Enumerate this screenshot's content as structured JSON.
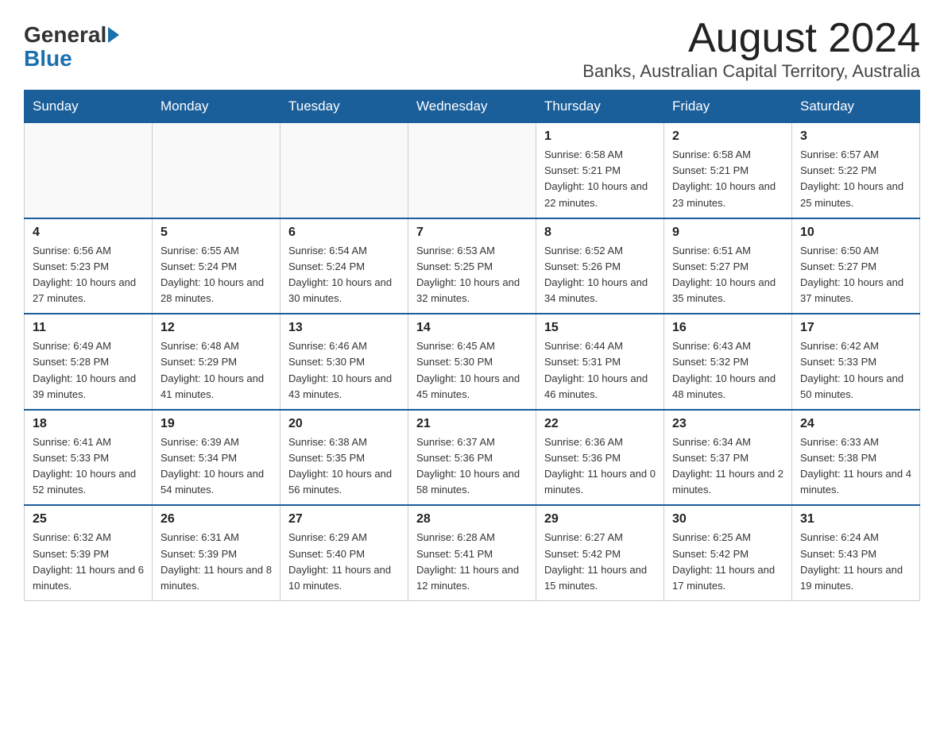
{
  "header": {
    "logo_text_general": "General",
    "logo_text_blue": "Blue",
    "month_title": "August 2024",
    "location": "Banks, Australian Capital Territory, Australia"
  },
  "calendar": {
    "days_of_week": [
      "Sunday",
      "Monday",
      "Tuesday",
      "Wednesday",
      "Thursday",
      "Friday",
      "Saturday"
    ],
    "weeks": [
      [
        {
          "day": "",
          "info": ""
        },
        {
          "day": "",
          "info": ""
        },
        {
          "day": "",
          "info": ""
        },
        {
          "day": "",
          "info": ""
        },
        {
          "day": "1",
          "info": "Sunrise: 6:58 AM\nSunset: 5:21 PM\nDaylight: 10 hours and 22 minutes."
        },
        {
          "day": "2",
          "info": "Sunrise: 6:58 AM\nSunset: 5:21 PM\nDaylight: 10 hours and 23 minutes."
        },
        {
          "day": "3",
          "info": "Sunrise: 6:57 AM\nSunset: 5:22 PM\nDaylight: 10 hours and 25 minutes."
        }
      ],
      [
        {
          "day": "4",
          "info": "Sunrise: 6:56 AM\nSunset: 5:23 PM\nDaylight: 10 hours and 27 minutes."
        },
        {
          "day": "5",
          "info": "Sunrise: 6:55 AM\nSunset: 5:24 PM\nDaylight: 10 hours and 28 minutes."
        },
        {
          "day": "6",
          "info": "Sunrise: 6:54 AM\nSunset: 5:24 PM\nDaylight: 10 hours and 30 minutes."
        },
        {
          "day": "7",
          "info": "Sunrise: 6:53 AM\nSunset: 5:25 PM\nDaylight: 10 hours and 32 minutes."
        },
        {
          "day": "8",
          "info": "Sunrise: 6:52 AM\nSunset: 5:26 PM\nDaylight: 10 hours and 34 minutes."
        },
        {
          "day": "9",
          "info": "Sunrise: 6:51 AM\nSunset: 5:27 PM\nDaylight: 10 hours and 35 minutes."
        },
        {
          "day": "10",
          "info": "Sunrise: 6:50 AM\nSunset: 5:27 PM\nDaylight: 10 hours and 37 minutes."
        }
      ],
      [
        {
          "day": "11",
          "info": "Sunrise: 6:49 AM\nSunset: 5:28 PM\nDaylight: 10 hours and 39 minutes."
        },
        {
          "day": "12",
          "info": "Sunrise: 6:48 AM\nSunset: 5:29 PM\nDaylight: 10 hours and 41 minutes."
        },
        {
          "day": "13",
          "info": "Sunrise: 6:46 AM\nSunset: 5:30 PM\nDaylight: 10 hours and 43 minutes."
        },
        {
          "day": "14",
          "info": "Sunrise: 6:45 AM\nSunset: 5:30 PM\nDaylight: 10 hours and 45 minutes."
        },
        {
          "day": "15",
          "info": "Sunrise: 6:44 AM\nSunset: 5:31 PM\nDaylight: 10 hours and 46 minutes."
        },
        {
          "day": "16",
          "info": "Sunrise: 6:43 AM\nSunset: 5:32 PM\nDaylight: 10 hours and 48 minutes."
        },
        {
          "day": "17",
          "info": "Sunrise: 6:42 AM\nSunset: 5:33 PM\nDaylight: 10 hours and 50 minutes."
        }
      ],
      [
        {
          "day": "18",
          "info": "Sunrise: 6:41 AM\nSunset: 5:33 PM\nDaylight: 10 hours and 52 minutes."
        },
        {
          "day": "19",
          "info": "Sunrise: 6:39 AM\nSunset: 5:34 PM\nDaylight: 10 hours and 54 minutes."
        },
        {
          "day": "20",
          "info": "Sunrise: 6:38 AM\nSunset: 5:35 PM\nDaylight: 10 hours and 56 minutes."
        },
        {
          "day": "21",
          "info": "Sunrise: 6:37 AM\nSunset: 5:36 PM\nDaylight: 10 hours and 58 minutes."
        },
        {
          "day": "22",
          "info": "Sunrise: 6:36 AM\nSunset: 5:36 PM\nDaylight: 11 hours and 0 minutes."
        },
        {
          "day": "23",
          "info": "Sunrise: 6:34 AM\nSunset: 5:37 PM\nDaylight: 11 hours and 2 minutes."
        },
        {
          "day": "24",
          "info": "Sunrise: 6:33 AM\nSunset: 5:38 PM\nDaylight: 11 hours and 4 minutes."
        }
      ],
      [
        {
          "day": "25",
          "info": "Sunrise: 6:32 AM\nSunset: 5:39 PM\nDaylight: 11 hours and 6 minutes."
        },
        {
          "day": "26",
          "info": "Sunrise: 6:31 AM\nSunset: 5:39 PM\nDaylight: 11 hours and 8 minutes."
        },
        {
          "day": "27",
          "info": "Sunrise: 6:29 AM\nSunset: 5:40 PM\nDaylight: 11 hours and 10 minutes."
        },
        {
          "day": "28",
          "info": "Sunrise: 6:28 AM\nSunset: 5:41 PM\nDaylight: 11 hours and 12 minutes."
        },
        {
          "day": "29",
          "info": "Sunrise: 6:27 AM\nSunset: 5:42 PM\nDaylight: 11 hours and 15 minutes."
        },
        {
          "day": "30",
          "info": "Sunrise: 6:25 AM\nSunset: 5:42 PM\nDaylight: 11 hours and 17 minutes."
        },
        {
          "day": "31",
          "info": "Sunrise: 6:24 AM\nSunset: 5:43 PM\nDaylight: 11 hours and 19 minutes."
        }
      ]
    ]
  }
}
